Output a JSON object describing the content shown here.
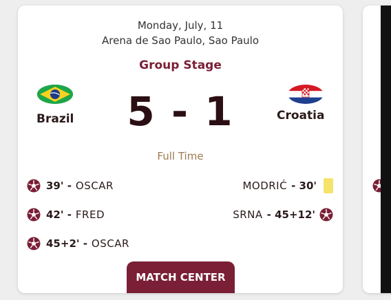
{
  "match": {
    "date": "Monday, July, 11",
    "venue": "Arena de Sao Paulo, Sao Paulo",
    "stage": "Group Stage",
    "score": "5 - 1",
    "status": "Full Time"
  },
  "home": {
    "name": "Brazil",
    "flag_icon": "brazil-flag-icon"
  },
  "away": {
    "name": "Croatia",
    "flag_icon": "croatia-flag-icon"
  },
  "home_events": [
    {
      "minute": "39' -",
      "player": "OSCAR",
      "type": "goal"
    },
    {
      "minute": "42' -",
      "player": "FRED",
      "type": "goal"
    },
    {
      "minute": "45+2' -",
      "player": "OSCAR",
      "type": "goal"
    }
  ],
  "away_events": [
    {
      "player": "MODRIĆ",
      "minute": "- 30'",
      "type": "yellow-card"
    },
    {
      "player": "SRNA",
      "minute": "- 45+12'",
      "type": "goal"
    }
  ],
  "button": {
    "match_center": "MATCH CENTER"
  },
  "colors": {
    "accent": "#7a1f36",
    "status": "#9c7a4e",
    "yellow_card": "#f5e36c"
  }
}
